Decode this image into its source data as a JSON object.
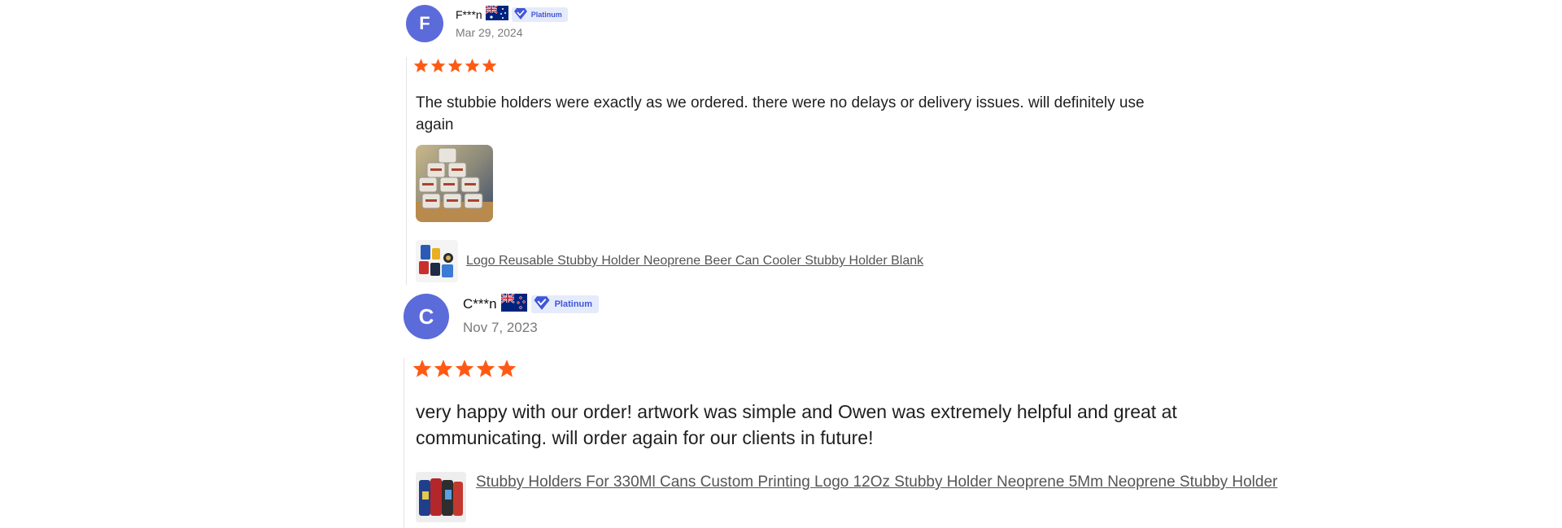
{
  "reviews": [
    {
      "avatar_letter": "F",
      "name": "F***n",
      "country_flag": "australia",
      "badge": "Platinum",
      "date": "Mar 29, 2024",
      "rating": 5,
      "text": "The stubbie holders were exactly as we ordered. there were no delays or delivery issues. will definitely use again",
      "product_link": "Logo Reusable Stubby Holder Neoprene Beer Can Cooler Stubby Holder Blank"
    },
    {
      "avatar_letter": "C",
      "name": "C***n",
      "country_flag": "new-zealand",
      "badge": "Platinum",
      "date": "Nov 7, 2023",
      "rating": 5,
      "text": "very happy with our order! artwork was simple and Owen was extremely helpful and great at communicating. will order again for our clients in future!",
      "product_link": "Stubby Holders For 330Ml Cans Custom Printing Logo 12Oz Stubby Holder Neoprene 5Mm Neoprene Stubby Holder"
    }
  ],
  "colors": {
    "avatar": "#5b6bd9",
    "star": "#ff5a14",
    "badge_bg": "#e6ebfb",
    "badge_text": "#3f56d8"
  }
}
